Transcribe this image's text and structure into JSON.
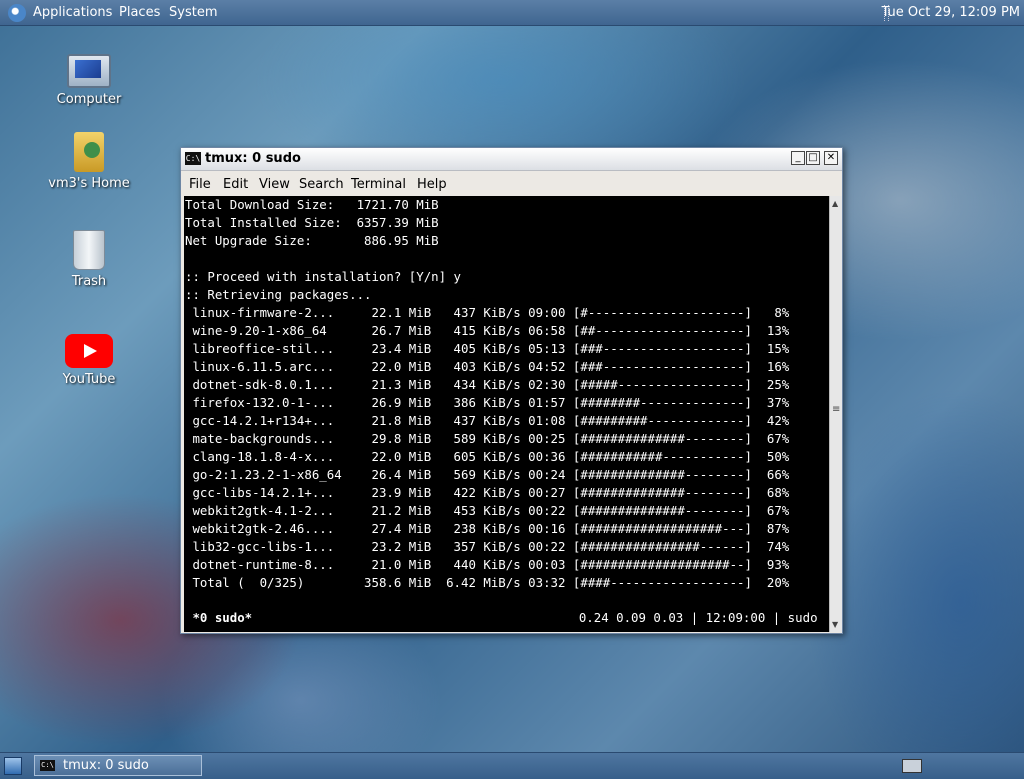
{
  "top_panel": {
    "menus": [
      "Applications",
      "Places",
      "System"
    ],
    "clock": "Tue Oct 29, 12:09 PM"
  },
  "desktop_icons": [
    {
      "label": "Computer",
      "icon": "computer-icon"
    },
    {
      "label": "vm3's Home",
      "icon": "home-folder-icon"
    },
    {
      "label": "Trash",
      "icon": "trash-icon"
    },
    {
      "label": "YouTube",
      "icon": "youtube-icon"
    }
  ],
  "window": {
    "title": "tmux: 0 sudo",
    "title_icon": "C:\\",
    "buttons": [
      "_",
      "□",
      "✕"
    ],
    "menus": [
      "File",
      "Edit",
      "View",
      "Search",
      "Terminal",
      "Help"
    ]
  },
  "terminal": {
    "lines": [
      "Total Download Size:   1721.70 MiB",
      "Total Installed Size:  6357.39 MiB",
      "Net Upgrade Size:       886.95 MiB",
      "",
      ":: Proceed with installation? [Y/n] y",
      ":: Retrieving packages...",
      " linux-firmware-2...     22.1 MiB   437 KiB/s 09:00 [#---------------------]   8%",
      " wine-9.20-1-x86_64      26.7 MiB   415 KiB/s 06:58 [##--------------------]  13%",
      " libreoffice-stil...     23.4 MiB   405 KiB/s 05:13 [###-------------------]  15%",
      " linux-6.11.5.arc...     22.0 MiB   403 KiB/s 04:52 [###-------------------]  16%",
      " dotnet-sdk-8.0.1...     21.3 MiB   434 KiB/s 02:30 [#####-----------------]  25%",
      " firefox-132.0-1-...     26.9 MiB   386 KiB/s 01:57 [########--------------]  37%",
      " gcc-14.2.1+r134+...     21.8 MiB   437 KiB/s 01:08 [#########-------------]  42%",
      " mate-backgrounds...     29.8 MiB   589 KiB/s 00:25 [##############--------]  67%",
      " clang-18.1.8-4-x...     22.0 MiB   605 KiB/s 00:36 [###########-----------]  50%",
      " go-2:1.23.2-1-x86_64    26.4 MiB   569 KiB/s 00:24 [##############--------]  66%",
      " gcc-libs-14.2.1+...     23.9 MiB   422 KiB/s 00:27 [##############--------]  68%",
      " webkit2gtk-4.1-2...     21.2 MiB   453 KiB/s 00:22 [##############--------]  67%",
      " webkit2gtk-2.46....     27.4 MiB   238 KiB/s 00:16 [###################---]  87%",
      " lib32-gcc-libs-1...     23.2 MiB   357 KiB/s 00:22 [################------]  74%",
      " dotnet-runtime-8...     21.0 MiB   440 KiB/s 00:03 [####################--]  93%",
      " Total (  0/325)        358.6 MiB  6.42 MiB/s 03:32 [####------------------]  20%"
    ],
    "status_left": " *0 sudo*",
    "status_right": "0.24 0.09 0.03 | 12:09:00 | sudo "
  },
  "bottom_panel": {
    "task_label": "tmux: 0 sudo"
  }
}
